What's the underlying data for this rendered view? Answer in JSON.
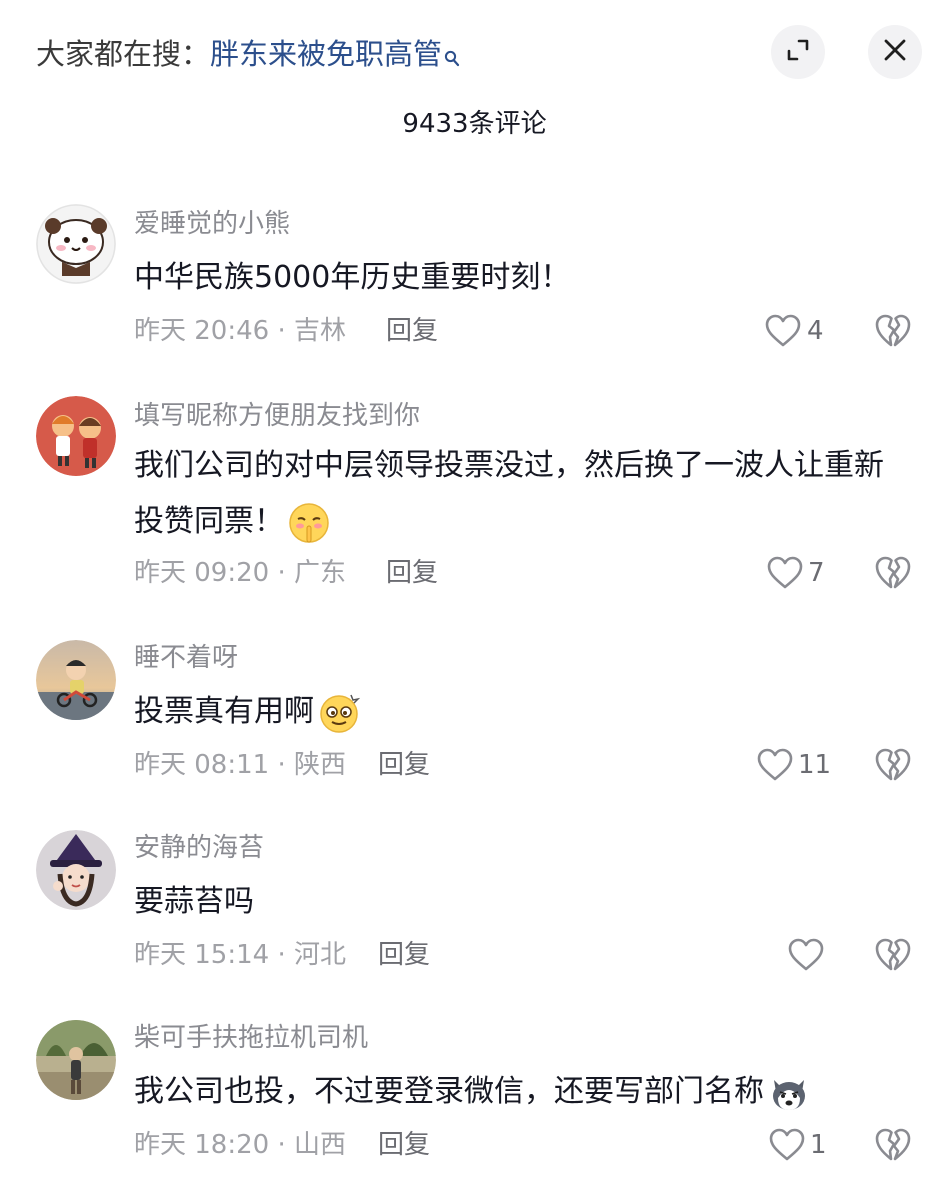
{
  "header": {
    "search_prefix": "大家都在搜：",
    "search_keyword": "胖东来被免职高管",
    "comment_count": "9433条评论"
  },
  "comments": [
    {
      "username": "爱睡觉的小熊",
      "text": "中华民族5000年历史重要时刻！",
      "time_location": "昨天 20:46 · 吉林",
      "reply_label": "回复",
      "likes": "4"
    },
    {
      "username": "填写昵称方便朋友找到你",
      "text": "我们公司的对中层领导投票没过，然后换了一波人让重新投赞同票！",
      "time_location": "昨天 09:20 · 广东",
      "reply_label": "回复",
      "likes": "7",
      "emoji": "shush-face-emoji"
    },
    {
      "username": "睡不着呀",
      "text": "投票真有用啊",
      "time_location": "昨天 08:11 · 陕西",
      "reply_label": "回复",
      "likes": "11",
      "emoji": "dizzy-face-emoji"
    },
    {
      "username": "安静的海苔",
      "text": "要蒜苔吗",
      "time_location": "昨天 15:14 · 河北",
      "reply_label": "回复",
      "likes": ""
    },
    {
      "username": "柴可手扶拖拉机司机",
      "text": "我公司也投，不过要登录微信，还要写部门名称",
      "time_location": "昨天 18:20 · 山西",
      "reply_label": "回复",
      "likes": "1",
      "emoji": "husky-dog-emoji"
    }
  ],
  "colors": {
    "keyword": "#2c4f8c",
    "meta_text": "#a0a1a6",
    "primary_text": "#161823",
    "button_bg": "#f2f2f4"
  }
}
